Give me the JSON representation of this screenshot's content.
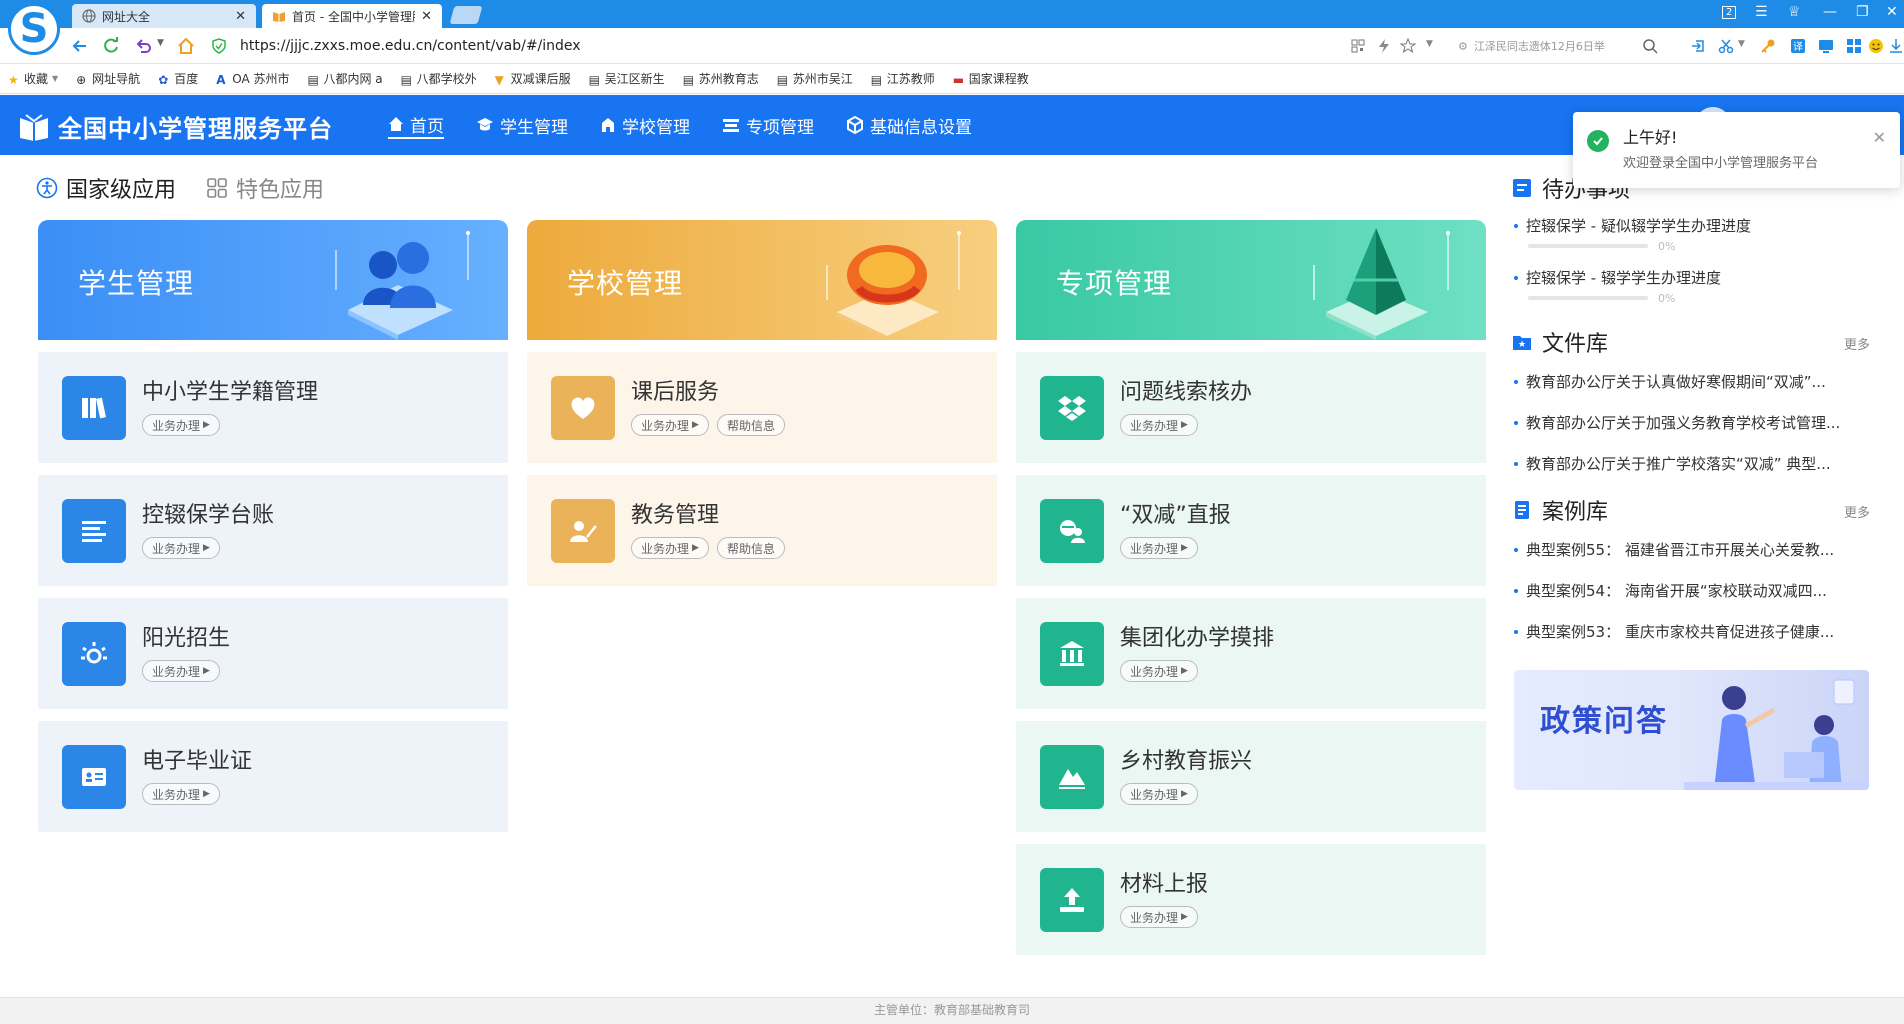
{
  "browser": {
    "tabs": [
      {
        "label": "网址大全",
        "active": false
      },
      {
        "label": "首页 - 全国中小学管理服",
        "active": true
      }
    ],
    "url": "https://jjjc.zxxs.moe.edu.cn/content/vab/#/index",
    "omnibox_hint": "江泽民同志遗体12月6日举",
    "window_badge": "2"
  },
  "bookmarks": [
    "收藏",
    "网址导航",
    "百度",
    "OA 苏州市",
    "八都内网 a",
    "八都学校外",
    "双减课后服",
    "吴江区新生",
    "苏州教育志",
    "苏州市吴江",
    "江苏教师",
    "国家课程教"
  ],
  "header": {
    "brand": "全国中小学管理服务平台",
    "nav": [
      "首页",
      "学生管理",
      "学校管理",
      "专项管理",
      "基础信息设置"
    ]
  },
  "section_tabs": {
    "national": "国家级应用",
    "featured": "特色应用"
  },
  "columns": {
    "student": {
      "title": "学生管理",
      "cards": [
        {
          "title": "中小学生学籍管理",
          "btn": "业务办理"
        },
        {
          "title": "控辍保学台账",
          "btn": "业务办理"
        },
        {
          "title": "阳光招生",
          "btn": "业务办理"
        },
        {
          "title": "电子毕业证",
          "btn": "业务办理"
        }
      ]
    },
    "school": {
      "title": "学校管理",
      "cards": [
        {
          "title": "课后服务",
          "btn": "业务办理",
          "help": "帮助信息"
        },
        {
          "title": "教务管理",
          "btn": "业务办理",
          "help": "帮助信息"
        }
      ]
    },
    "special": {
      "title": "专项管理",
      "cards": [
        {
          "title": "问题线索核办",
          "btn": "业务办理"
        },
        {
          "title": "“双减”直报",
          "btn": "业务办理"
        },
        {
          "title": "集团化办学摸排",
          "btn": "业务办理"
        },
        {
          "title": "乡村教育振兴",
          "btn": "业务办理"
        },
        {
          "title": "材料上报",
          "btn": "业务办理"
        }
      ]
    }
  },
  "todo": {
    "title": "待办事项",
    "items": [
      {
        "text": "控辍保学 - 疑似辍学学生办理进度",
        "progress": 0,
        "progress_label": "0%"
      },
      {
        "text": "控辍保学 - 辍学学生办理进度",
        "progress": 0,
        "progress_label": "0%"
      }
    ]
  },
  "files": {
    "title": "文件库",
    "more": "更多",
    "items": [
      "教育部办公厅关于认真做好寒假期间“双减”...",
      "教育部办公厅关于加强义务教育学校考试管理...",
      "教育部办公厅关于推广学校落实“双减” 典型..."
    ]
  },
  "cases": {
    "title": "案例库",
    "more": "更多",
    "items": [
      "典型案例55：  福建省晋江市开展关心关爱教...",
      "典型案例54：  海南省开展“家校联动双减四...",
      "典型案例53：  重庆市家校共育促进孩子健康..."
    ]
  },
  "policy_banner": "政策问答",
  "toast": {
    "title": "上午好!",
    "message": "欢迎登录全国中小学管理服务平台"
  },
  "footer": "主管单位：教育部基础教育司"
}
